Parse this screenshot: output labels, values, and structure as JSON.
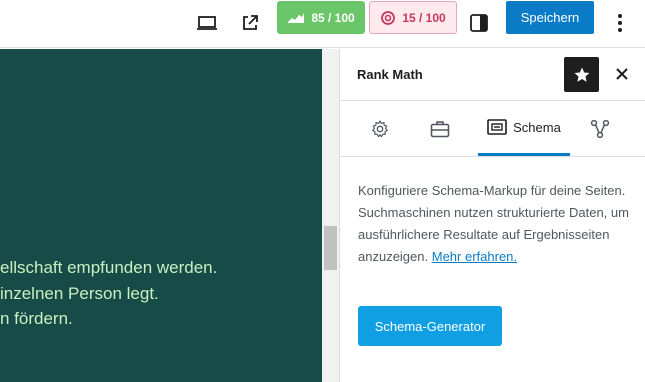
{
  "toolbar": {
    "seo_score": "85 / 100",
    "readability_score": "15 / 100",
    "save_label": "Speichern"
  },
  "canvas": {
    "lines": [
      "ellschaft empfunden werden.",
      "inzelnen Person legt.",
      "n fördern."
    ]
  },
  "sidebar": {
    "title": "Rank Math",
    "tabs": [
      {
        "icon": "gear-icon",
        "label": ""
      },
      {
        "icon": "briefcase-icon",
        "label": ""
      },
      {
        "icon": "schema-icon",
        "label": "Schema"
      },
      {
        "icon": "share-nodes-icon",
        "label": ""
      }
    ],
    "description": "Konfiguriere Schema-Markup für deine Seiten. Suchmaschinen nutzen strukturierte Daten, um ausführlichere Resultate auf Ergebnisseiten anzuzeigen.",
    "learn_more": "Mehr erfahren.",
    "generator_button": "Schema-Generator"
  },
  "colors": {
    "canvas_bg": "#164b47",
    "canvas_text": "#c9efc2",
    "accent": "#0a7cc7",
    "seo_score_bg": "#6bc66a",
    "readability_score_bg": "#fde9ee"
  }
}
